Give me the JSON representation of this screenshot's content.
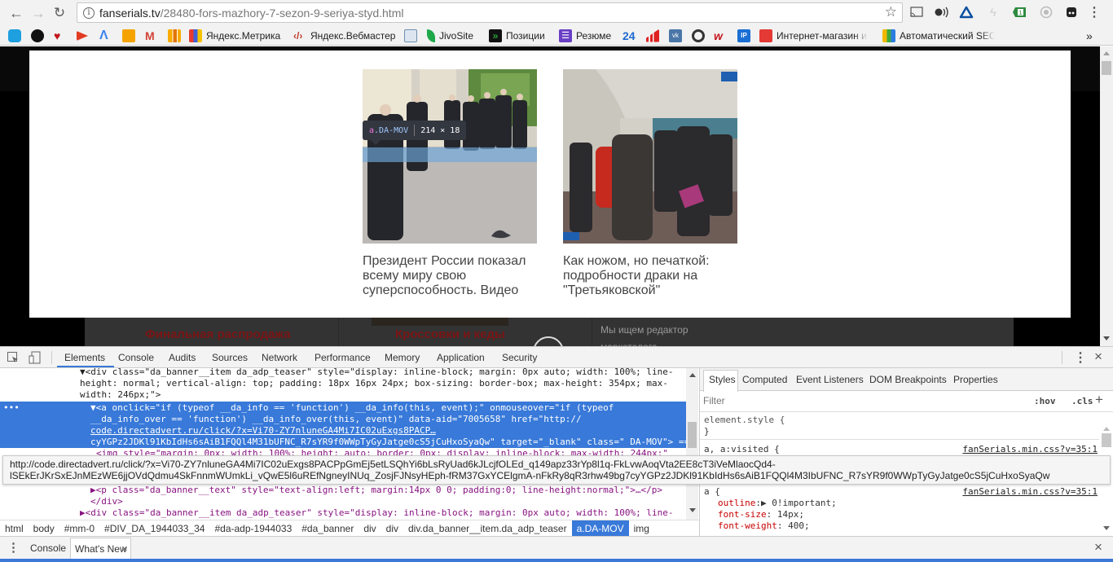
{
  "browser": {
    "url_domain": "fanserials.tv",
    "url_path": "/28480-fors-mazhory-7-sezon-9-seriya-styd.html",
    "extensions": [
      "cast-icon",
      "audio-icon",
      "alice-icon",
      "flash-icon",
      "tab-counter-icon",
      "record-icon",
      "ghostery-icon",
      "menu-icon"
    ],
    "tab_counter": "1",
    "bookmarks": [
      {
        "label": "",
        "icon": "clock-icon",
        "color": "#1e9fe0"
      },
      {
        "label": "",
        "icon": "cat-icon",
        "color": "#111111"
      },
      {
        "label": "",
        "icon": "heart-icon",
        "color": "#c0161c"
      },
      {
        "label": "",
        "icon": "arrow-icon",
        "color": "#e23b22"
      },
      {
        "label": "",
        "icon": "adwords-icon",
        "color": "#3b82f0"
      },
      {
        "label": "",
        "icon": "mail-icon",
        "color": "#f5a300"
      },
      {
        "label": "",
        "icon": "gmail-icon",
        "color": "#d34235"
      },
      {
        "label": "",
        "icon": "analytics-icon",
        "color": "#f29d00"
      },
      {
        "label": "Яндекс.Метрика",
        "icon": "metrika-icon",
        "color": "#e63c2f"
      },
      {
        "label": "Яндекс.Вебмастер",
        "icon": "webmaster-icon",
        "color": "#c0392b"
      },
      {
        "label": "",
        "icon": "briefcase-icon",
        "color": "#6f8fb3"
      },
      {
        "label": "JivoSite",
        "icon": "leaf-icon",
        "color": "#1ea84a"
      },
      {
        "label": "Позиции",
        "icon": "positions-icon",
        "color": "#1f8a2c"
      },
      {
        "label": "Резюме",
        "icon": "list-icon",
        "color": "#6a3fc6"
      },
      {
        "label": "",
        "icon": "24-icon",
        "color": "#1e6ad0",
        "text": "24"
      },
      {
        "label": "",
        "icon": "bars-icon",
        "color": "#e02121"
      },
      {
        "label": "",
        "icon": "vk-icon",
        "color": "#4a76a8"
      },
      {
        "label": "",
        "icon": "ring-icon",
        "color": "#333333"
      },
      {
        "label": "",
        "icon": "w-icon",
        "color": "#c4161c"
      },
      {
        "label": "",
        "icon": "ip-icon",
        "color": "#1a6fd4"
      },
      {
        "label": "Интернет-магазин и",
        "icon": "shop-icon",
        "color": "#e53935"
      },
      {
        "label": "Автоматический SEO",
        "icon": "seo-icon",
        "color": "#f2b800"
      }
    ],
    "overflow_label": "»"
  },
  "page": {
    "teasers": [
      {
        "title": "Президент России показал всему миру свою суперспособность. Видео"
      },
      {
        "title": "Как ножом, но печаткой: подробности драки на \"Третьяковской\""
      }
    ],
    "background_items": [
      {
        "title": "Финальная распродажа"
      },
      {
        "title": "Кроссовки и кеды"
      },
      {
        "text": "Мы ищем редактор"
      },
      {
        "text": "маркетолога"
      }
    ],
    "inspect_tooltip": {
      "tag": "a",
      "class": ".DA-MOV",
      "size": "214 × 18"
    }
  },
  "devtools": {
    "tabs": [
      "Elements",
      "Console",
      "Audits",
      "Sources",
      "Network",
      "Performance",
      "Memory",
      "Application",
      "Security"
    ],
    "active_tab": "Elements",
    "dom_lines": {
      "l1a": "▼<div class=\"da_banner__item da_adp_teaser\" style=\"display: inline-block; margin: 0px auto; width: 100%; line-",
      "l1b": "height: normal; vertical-align: top; padding: 18px 16px 24px; box-sizing: border-box; max-height: 354px; max-",
      "l1c": "width: 246px;\">",
      "sel1": "▼<a onclick=\"if (typeof __da_info == 'function') __da_info(this, event);\" onmouseover=\"if (typeof",
      "sel2": "__da_info_over == 'function') __da_info_over(this, event)\" data-aid=\"7005658\" href=\"http://",
      "sel3": "code.directadvert.ru/click/?x=Vi70-ZY7nluneGA4Mi7IC02uExgs8PACP…",
      "sel4": "cyYGPz2JDKl91KbIdHs6sAiB1FQQl4M31bUFNC_R7sYR9f0WWpTyGyJatge0cS5jCuHxoSyaQw\" target=\"_blank\" class=\" DA-MOV\"> == $0",
      "img": "<img style=\"margin: 0px; width: 100%; height: auto; border: 0px; display: inline-block; max-width: 244px;\"",
      "p": "▶<p class=\"da_banner__text\" style=\"text-align:left; margin:14px 0 0; padding:0; line-height:normal;\">…</p>",
      "divclose": "</div>",
      "div2": "▶<div class=\"da_banner__item da_adp_teaser\" style=\"display: inline-block; margin: 0px auto; width: 100%; line-"
    },
    "row_ellipsis": "…",
    "link_tooltip": {
      "line1": "http://code.directadvert.ru/click/?x=Vi70-ZY7nluneGA4Mi7IC02uExgs8PACPpGmEj5etLSQhYi6bLsRyUad6kJLcjfOLEd_q149apz33rYp8l1q-FkLvwAoqVta2EE8cT3iVeMlaocQd4-",
      "line2": "lSEkErJKrSxEJnMEzWE6jjOVdQdmu4SkFnnmWUmkLi_vQwE5l6uREfNgneyINUq_ZosjFJNsyHEph-fRM37GxYCElgmA-nFkRy8qR3rhw49bg7cyYGPz2JDKl91KbIdHs6sAiB1FQQl4M3IbUFNC_R7sYR9f0WWpTyGyJatge0cS5jCuHxoSyaQw"
    },
    "breadcrumbs": [
      "html",
      "body",
      "#mm-0",
      "#DIV_DA_1944033_34",
      "#da-adp-1944033",
      "#da_banner",
      "div",
      "div",
      "div.da_banner__item.da_adp_teaser",
      "a.DA-MOV",
      "img"
    ],
    "breadcrumb_selected": "a.DA-MOV",
    "side_tabs": [
      "Styles",
      "Computed",
      "Event Listeners",
      "DOM Breakpoints",
      "Properties"
    ],
    "side_active": "Styles",
    "filter_placeholder": "Filter",
    "hov": ":hov",
    "cls": ".cls",
    "plus": "+",
    "styles": {
      "element_style": "element.style {",
      "close": "}",
      "rule1_selector": "a, a:visited {",
      "rule1_source": "fanSerials.min.css?v=35:1",
      "rule2_selector": "a {",
      "rule2_source": "fanSerials.min.css?v=35:1",
      "rule2_props": [
        {
          "name": "outline",
          "value": "▶ 0!important;"
        },
        {
          "name": "font-size",
          "value": " 14px;"
        },
        {
          "name": "font-weight",
          "value": " 400;"
        }
      ]
    },
    "drawer_tabs": [
      "Console",
      "What's New"
    ],
    "drawer_active": "What's New",
    "close_glyph": "×"
  }
}
